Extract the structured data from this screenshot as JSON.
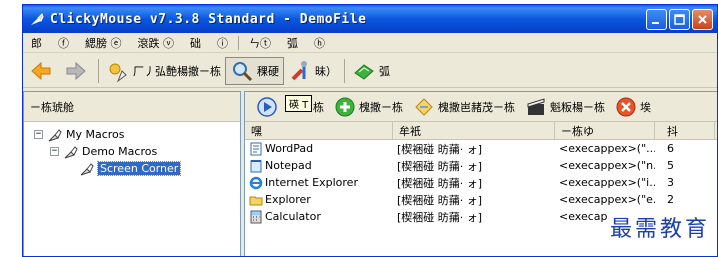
{
  "window": {
    "title": "ClickyMouse v7.3.8 Standard - DemoFile"
  },
  "menubar": {
    "items": [
      "郎",
      "ⓕ",
      "緦膀 ⓔ",
      "滾跌 ⓥ",
      "础",
      "ⓘ",
      "ㄣⓣ",
      "弧",
      "ⓗ"
    ]
  },
  "toolbar": {
    "back_label": "",
    "forward_label": "",
    "add_label": "厂丿弘艶楊撤ㄧ栋",
    "find_label": "稞硬",
    "tools_label": "昧）",
    "help_label": "弧"
  },
  "left_pane": {
    "header": "ㄧ栋琥舱",
    "tree": [
      {
        "label": "My Macros",
        "level": 0,
        "expander": "−"
      },
      {
        "label": "Demo Macros",
        "level": 1,
        "expander": "−"
      },
      {
        "label": "Screen Corner",
        "level": 2,
        "expander": "",
        "selected": true
      }
    ]
  },
  "right_pane": {
    "toolbar": {
      "run_label": "栋",
      "new_label": "槐撒ㄧ栋",
      "edit_label": "槐撒岜赭茂ㄧ栋",
      "copy_label": "魁粄楊ㄧ栋",
      "delete_label": "埃"
    },
    "tooltip": "碤 T",
    "columns": [
      "嘿",
      "牟衹",
      "ㄧ栋ゆ",
      "抖"
    ],
    "rows": [
      {
        "name": "WordPad",
        "icon": "wordpad-icon",
        "type": "[楔裍碰     昉蒱·  ォ]",
        "action": "<execappex>(\"...",
        "count": "6"
      },
      {
        "name": "Notepad",
        "icon": "notepad-icon",
        "type": "[楔裍碰     昉蒱·  ォ]",
        "action": "<execappex>(\"n...",
        "count": "5"
      },
      {
        "name": "Internet Explorer",
        "icon": "ie-icon",
        "type": "[楔裍碰     昉蒱·  ォ]",
        "action": "<execappex>(\"i...",
        "count": "3"
      },
      {
        "name": "Explorer",
        "icon": "folder-icon",
        "type": "[楔裍碰     昉蒱·  ォ]",
        "action": "<execappex>(\"e...",
        "count": "2"
      },
      {
        "name": "Calculator",
        "icon": "calculator-icon",
        "type": "[楔裍碰     昉蒱·  ォ]",
        "action": "<execap",
        "count": ""
      }
    ]
  },
  "watermark": "最需教育",
  "colors": {
    "titlebar": "#0b58e0",
    "selection": "#316ac5",
    "watermark": "#1f3fa8"
  }
}
